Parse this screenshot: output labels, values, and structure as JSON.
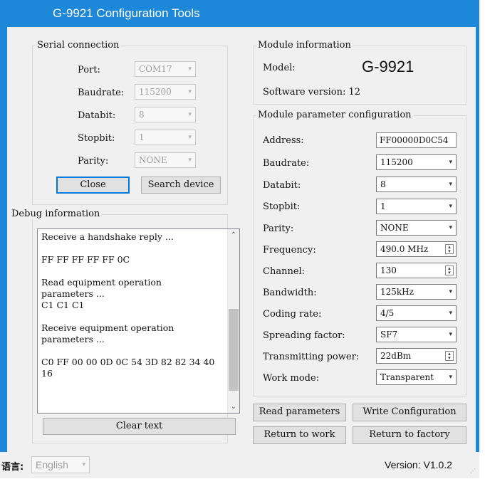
{
  "window": {
    "title": "G-9921 Configuration Tools"
  },
  "serial": {
    "legend": "Serial connection",
    "port_label": "Port:",
    "port_value": "COM17",
    "baud_label": "Baudrate:",
    "baud_value": "115200",
    "databit_label": "Databit:",
    "databit_value": "8",
    "stopbit_label": "Stopbit:",
    "stopbit_value": "1",
    "parity_label": "Parity:",
    "parity_value": "NONE",
    "close_label": "Close",
    "search_label": "Search device"
  },
  "debug": {
    "legend": "Debug information",
    "text": "Receive a handshake reply ...\n\nFF FF FF FF FF 0C\n\nRead equipment operation parameters ...\nC1 C1 C1\n\nReceive equipment operation parameters ...\n\nC0 FF 00 00 0D 0C 54 3D 82 82 34 40 16",
    "clear_label": "Clear text"
  },
  "module_info": {
    "legend": "Module information",
    "model_label": "Model:",
    "model_value": "G-9921",
    "software_label": "Software version: 12"
  },
  "params": {
    "legend": "Module parameter configuration",
    "address_label": "Address:",
    "address_value": "FF00000D0C54",
    "baud_label": "Baudrate:",
    "baud_value": "115200",
    "databit_label": "Databit:",
    "databit_value": "8",
    "stopbit_label": "Stopbit:",
    "stopbit_value": "1",
    "parity_label": "Parity:",
    "parity_value": "NONE",
    "freq_label": "Frequency:",
    "freq_value": "490.0 MHz",
    "channel_label": "Channel:",
    "channel_value": "130",
    "bandwidth_label": "Bandwidth:",
    "bandwidth_value": "125kHz",
    "coding_label": "Coding rate:",
    "coding_value": "4/5",
    "sf_label": "Spreading factor:",
    "sf_value": "SF7",
    "power_label": "Transmitting power:",
    "power_value": "22dBm",
    "mode_label": "Work mode:",
    "mode_value": "Transparent"
  },
  "actions": {
    "read": "Read parameters",
    "write": "Write Configuration",
    "return_work": "Return to work",
    "return_factory": "Return to factory"
  },
  "status": {
    "lang_label": "语言:",
    "lang_value": "English",
    "version": "Version: V1.0.2"
  },
  "icons": {
    "dropdown": "chevron-down-icon",
    "spinner": "spin-updown-icon",
    "resize": "resize-grip-icon"
  }
}
